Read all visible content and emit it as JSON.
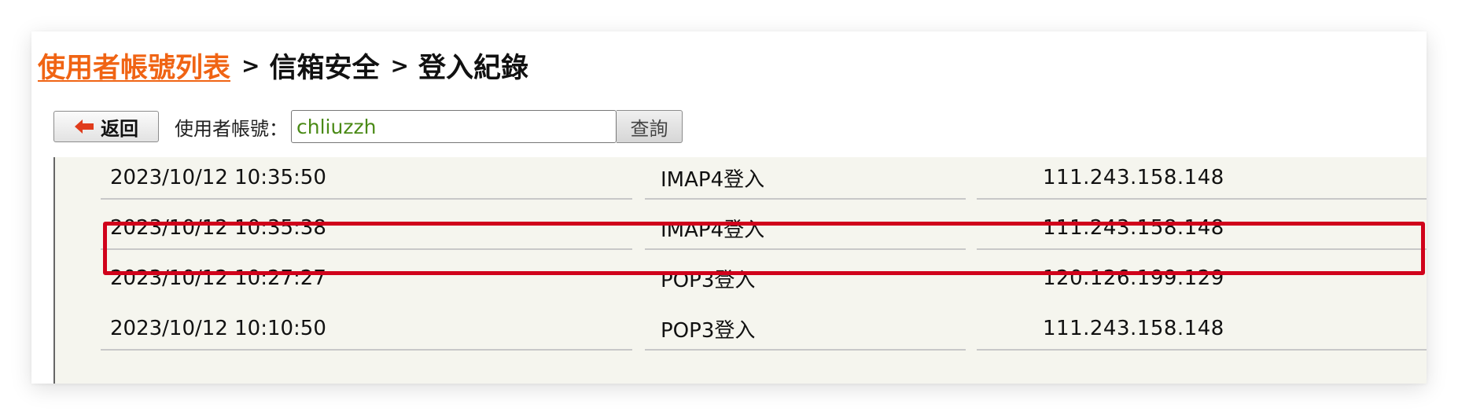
{
  "breadcrumb": {
    "user_list_link": "使用者帳號列表",
    "sep1": ">",
    "mailbox_security": "信箱安全",
    "sep2": ">",
    "current": "登入紀錄"
  },
  "toolbar": {
    "back_label": "返回",
    "account_label": "使用者帳號：",
    "account_value": "chliuzzh",
    "query_label": "查詢"
  },
  "login_records": [
    {
      "time": "2023/10/12 10:35:50",
      "type": "IMAP4登入",
      "ip": "111.243.158.148"
    },
    {
      "time": "2023/10/12 10:35:38",
      "type": "IMAP4登入",
      "ip": "111.243.158.148"
    },
    {
      "time": "2023/10/12 10:27:27",
      "type": "POP3登入",
      "ip": "120.126.199.129"
    },
    {
      "time": "2023/10/12 10:10:50",
      "type": "POP3登入",
      "ip": "111.243.158.148"
    }
  ],
  "colors": {
    "link": "#f06414",
    "highlight": "#d0021b",
    "input_text": "#4a8a16",
    "back_arrow": "#e03c1c",
    "row_bg": "#f5f5ee"
  },
  "icons": {
    "back": "left-arrow-icon"
  }
}
